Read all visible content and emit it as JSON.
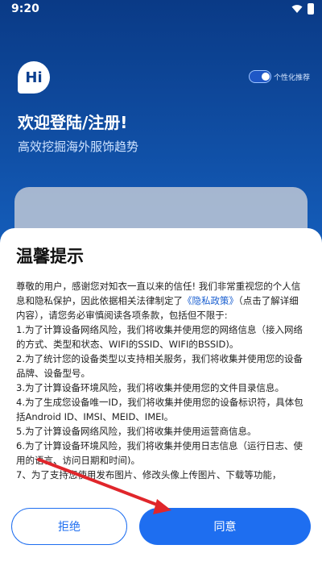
{
  "status_bar": {
    "time": "9:20",
    "icons": [
      "wifi-icon",
      "battery-icon"
    ]
  },
  "background": {
    "badge_text": "Hi",
    "toggle_label": "个性化推荐",
    "toggle_on": true,
    "welcome_title": "欢迎登陆/注册!",
    "welcome_subtitle": "高效挖掘海外服饰趋势"
  },
  "dialog": {
    "title": "温馨提示",
    "paragraphs": [
      {
        "before": "尊敬的用户，感谢您对知衣一直以来的信任! 我们非常重视您的个人信息和隐私保护，因此依据相关法律制定了",
        "link": "《隐私政策》",
        "after": "（点击了解详细内容），请您务必审慎阅读各项条款，包括但不限于:"
      },
      {
        "text": "1.为了计算设备网络风险，我们将收集并使用您的网络信息（接入网络的方式、类型和状态、WIFI的SSID、WIFI的BSSID)。"
      },
      {
        "text": "2.为了统计您的设备类型以支持相关服务，我们将收集并使用您的设备品牌、设备型号。"
      },
      {
        "text": "3.为了计算设备环境风险，我们将收集并使用您的文件目录信息。"
      },
      {
        "text": "4.为了生成您设备唯一ID，我们将收集并使用您的设备标识符，具体包括Android ID、IMSI、MEID、IMEI。"
      },
      {
        "text": "5.为了计算设备网络风险，我们将收集并使用运营商信息。"
      },
      {
        "text": "6.为了计算设备环境风险，我们将收集并使用日志信息（运行日志、使用的语言、访问日期和时间)。"
      },
      {
        "text": "7、为了支持您使用发布图片、修改头像上传图片、下载等功能，"
      }
    ],
    "refuse_label": "拒绝",
    "agree_label": "同意"
  },
  "colors": {
    "primary": "#1e6ef0",
    "annotation_arrow": "#e0262b"
  }
}
